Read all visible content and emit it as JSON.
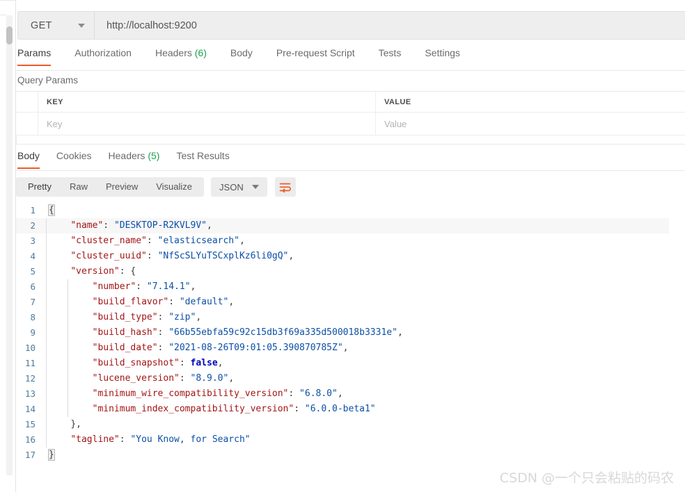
{
  "request": {
    "method": "GET",
    "url": "http://localhost:9200",
    "tabs": [
      {
        "label": "Params",
        "active": true,
        "count": ""
      },
      {
        "label": "Authorization",
        "active": false,
        "count": ""
      },
      {
        "label": "Headers",
        "active": false,
        "count": "(6)"
      },
      {
        "label": "Body",
        "active": false,
        "count": ""
      },
      {
        "label": "Pre-request Script",
        "active": false,
        "count": ""
      },
      {
        "label": "Tests",
        "active": false,
        "count": ""
      },
      {
        "label": "Settings",
        "active": false,
        "count": ""
      }
    ]
  },
  "query_params": {
    "title": "Query Params",
    "columns": [
      "KEY",
      "VALUE"
    ],
    "placeholder_row": {
      "key": "Key",
      "value": "Value"
    }
  },
  "response": {
    "tabs": [
      {
        "label": "Body",
        "active": true,
        "count": ""
      },
      {
        "label": "Cookies",
        "active": false,
        "count": ""
      },
      {
        "label": "Headers",
        "active": false,
        "count": "(5)"
      },
      {
        "label": "Test Results",
        "active": false,
        "count": ""
      }
    ],
    "view_modes": [
      {
        "label": "Pretty",
        "active": true
      },
      {
        "label": "Raw",
        "active": false
      },
      {
        "label": "Preview",
        "active": false
      },
      {
        "label": "Visualize",
        "active": false
      }
    ],
    "format": "JSON",
    "wrap_icon": "wrap-lines-icon",
    "body_lines": [
      {
        "n": 1,
        "highlight": false,
        "fold1": false,
        "fold2": false,
        "parts": [
          {
            "t": "{",
            "c": "brk match"
          }
        ]
      },
      {
        "n": 2,
        "highlight": true,
        "fold1": true,
        "fold2": false,
        "parts": [
          {
            "t": "    ",
            "c": "p"
          },
          {
            "t": "\"name\"",
            "c": "k"
          },
          {
            "t": ": ",
            "c": "p"
          },
          {
            "t": "\"DESKTOP-R2KVL9V\"",
            "c": "s"
          },
          {
            "t": ",",
            "c": "p"
          }
        ]
      },
      {
        "n": 3,
        "highlight": false,
        "fold1": true,
        "fold2": false,
        "parts": [
          {
            "t": "    ",
            "c": "p"
          },
          {
            "t": "\"cluster_name\"",
            "c": "k"
          },
          {
            "t": ": ",
            "c": "p"
          },
          {
            "t": "\"elasticsearch\"",
            "c": "s"
          },
          {
            "t": ",",
            "c": "p"
          }
        ]
      },
      {
        "n": 4,
        "highlight": false,
        "fold1": true,
        "fold2": false,
        "parts": [
          {
            "t": "    ",
            "c": "p"
          },
          {
            "t": "\"cluster_uuid\"",
            "c": "k"
          },
          {
            "t": ": ",
            "c": "p"
          },
          {
            "t": "\"NfScSLYuTSCxplKz6li0gQ\"",
            "c": "s"
          },
          {
            "t": ",",
            "c": "p"
          }
        ]
      },
      {
        "n": 5,
        "highlight": false,
        "fold1": true,
        "fold2": false,
        "parts": [
          {
            "t": "    ",
            "c": "p"
          },
          {
            "t": "\"version\"",
            "c": "k"
          },
          {
            "t": ": ",
            "c": "p"
          },
          {
            "t": "{",
            "c": "brk"
          }
        ]
      },
      {
        "n": 6,
        "highlight": false,
        "fold1": true,
        "fold2": true,
        "parts": [
          {
            "t": "        ",
            "c": "p"
          },
          {
            "t": "\"number\"",
            "c": "k"
          },
          {
            "t": ": ",
            "c": "p"
          },
          {
            "t": "\"7.14.1\"",
            "c": "s"
          },
          {
            "t": ",",
            "c": "p"
          }
        ]
      },
      {
        "n": 7,
        "highlight": false,
        "fold1": true,
        "fold2": true,
        "parts": [
          {
            "t": "        ",
            "c": "p"
          },
          {
            "t": "\"build_flavor\"",
            "c": "k"
          },
          {
            "t": ": ",
            "c": "p"
          },
          {
            "t": "\"default\"",
            "c": "s"
          },
          {
            "t": ",",
            "c": "p"
          }
        ]
      },
      {
        "n": 8,
        "highlight": false,
        "fold1": true,
        "fold2": true,
        "parts": [
          {
            "t": "        ",
            "c": "p"
          },
          {
            "t": "\"build_type\"",
            "c": "k"
          },
          {
            "t": ": ",
            "c": "p"
          },
          {
            "t": "\"zip\"",
            "c": "s"
          },
          {
            "t": ",",
            "c": "p"
          }
        ]
      },
      {
        "n": 9,
        "highlight": false,
        "fold1": true,
        "fold2": true,
        "parts": [
          {
            "t": "        ",
            "c": "p"
          },
          {
            "t": "\"build_hash\"",
            "c": "k"
          },
          {
            "t": ": ",
            "c": "p"
          },
          {
            "t": "\"66b55ebfa59c92c15db3f69a335d500018b3331e\"",
            "c": "s"
          },
          {
            "t": ",",
            "c": "p"
          }
        ]
      },
      {
        "n": 10,
        "highlight": false,
        "fold1": true,
        "fold2": true,
        "parts": [
          {
            "t": "        ",
            "c": "p"
          },
          {
            "t": "\"build_date\"",
            "c": "k"
          },
          {
            "t": ": ",
            "c": "p"
          },
          {
            "t": "\"2021-08-26T09:01:05.390870785Z\"",
            "c": "s"
          },
          {
            "t": ",",
            "c": "p"
          }
        ]
      },
      {
        "n": 11,
        "highlight": false,
        "fold1": true,
        "fold2": true,
        "parts": [
          {
            "t": "        ",
            "c": "p"
          },
          {
            "t": "\"build_snapshot\"",
            "c": "k"
          },
          {
            "t": ": ",
            "c": "p"
          },
          {
            "t": "false",
            "c": "b"
          },
          {
            "t": ",",
            "c": "p"
          }
        ]
      },
      {
        "n": 12,
        "highlight": false,
        "fold1": true,
        "fold2": true,
        "parts": [
          {
            "t": "        ",
            "c": "p"
          },
          {
            "t": "\"lucene_version\"",
            "c": "k"
          },
          {
            "t": ": ",
            "c": "p"
          },
          {
            "t": "\"8.9.0\"",
            "c": "s"
          },
          {
            "t": ",",
            "c": "p"
          }
        ]
      },
      {
        "n": 13,
        "highlight": false,
        "fold1": true,
        "fold2": true,
        "parts": [
          {
            "t": "        ",
            "c": "p"
          },
          {
            "t": "\"minimum_wire_compatibility_version\"",
            "c": "k"
          },
          {
            "t": ": ",
            "c": "p"
          },
          {
            "t": "\"6.8.0\"",
            "c": "s"
          },
          {
            "t": ",",
            "c": "p"
          }
        ]
      },
      {
        "n": 14,
        "highlight": false,
        "fold1": true,
        "fold2": true,
        "parts": [
          {
            "t": "        ",
            "c": "p"
          },
          {
            "t": "\"minimum_index_compatibility_version\"",
            "c": "k"
          },
          {
            "t": ": ",
            "c": "p"
          },
          {
            "t": "\"6.0.0-beta1\"",
            "c": "s"
          }
        ]
      },
      {
        "n": 15,
        "highlight": false,
        "fold1": true,
        "fold2": false,
        "parts": [
          {
            "t": "    ",
            "c": "p"
          },
          {
            "t": "}",
            "c": "brk"
          },
          {
            "t": ",",
            "c": "p"
          }
        ]
      },
      {
        "n": 16,
        "highlight": false,
        "fold1": true,
        "fold2": false,
        "parts": [
          {
            "t": "    ",
            "c": "p"
          },
          {
            "t": "\"tagline\"",
            "c": "k"
          },
          {
            "t": ": ",
            "c": "p"
          },
          {
            "t": "\"You Know, for Search\"",
            "c": "s"
          }
        ]
      },
      {
        "n": 17,
        "highlight": false,
        "fold1": false,
        "fold2": false,
        "parts": [
          {
            "t": "}",
            "c": "brk match"
          }
        ]
      }
    ]
  },
  "watermark": "CSDN @一个只会粘贴的码农",
  "colors": {
    "accent": "#ef5b25",
    "count_green": "#1aa251",
    "json_key": "#a31515",
    "json_string": "#0b4fa6",
    "json_bool": "#0000c0",
    "gutter": "#4a7a9b"
  }
}
